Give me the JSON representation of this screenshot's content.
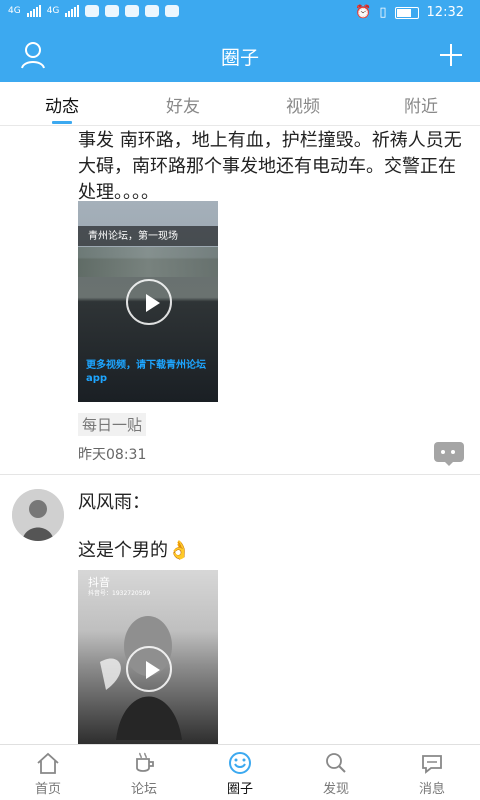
{
  "status": {
    "network_a": "4G",
    "network_b": "4G",
    "time": "12:32"
  },
  "app": {
    "title": "圈子",
    "colors": {
      "primary": "#3ca9f0",
      "text": "#222222",
      "muted": "#888888"
    }
  },
  "tabs": [
    {
      "label": "动态",
      "active": true
    },
    {
      "label": "好友",
      "active": false
    },
    {
      "label": "视频",
      "active": false
    },
    {
      "label": "附近",
      "active": false
    }
  ],
  "posts": [
    {
      "text": "事发 南环路，地上有血，护栏撞毁。祈祷人员无大碍，南环路那个事发地还有电动车。交警正在处理。。。。",
      "video_caption_top": "青州论坛，第一现场",
      "video_caption_bottom": "更多视频，请下载青州论坛app",
      "tag": "每日一贴",
      "time": "昨天08:31",
      "icons": {
        "play": "play-icon",
        "comment": "comment-icon"
      }
    },
    {
      "author": "风风雨：",
      "text": "这是个男的",
      "emoji": "👌",
      "video_brand": "抖音",
      "video_id": "抖音号：1932720599"
    }
  ],
  "bottom_nav": [
    {
      "label": "首页",
      "icon": "home-icon",
      "active": false
    },
    {
      "label": "论坛",
      "icon": "coffee-icon",
      "active": false
    },
    {
      "label": "圈子",
      "icon": "smile-icon",
      "active": true
    },
    {
      "label": "发现",
      "icon": "search-icon",
      "active": false
    },
    {
      "label": "消息",
      "icon": "message-icon",
      "active": false
    }
  ]
}
